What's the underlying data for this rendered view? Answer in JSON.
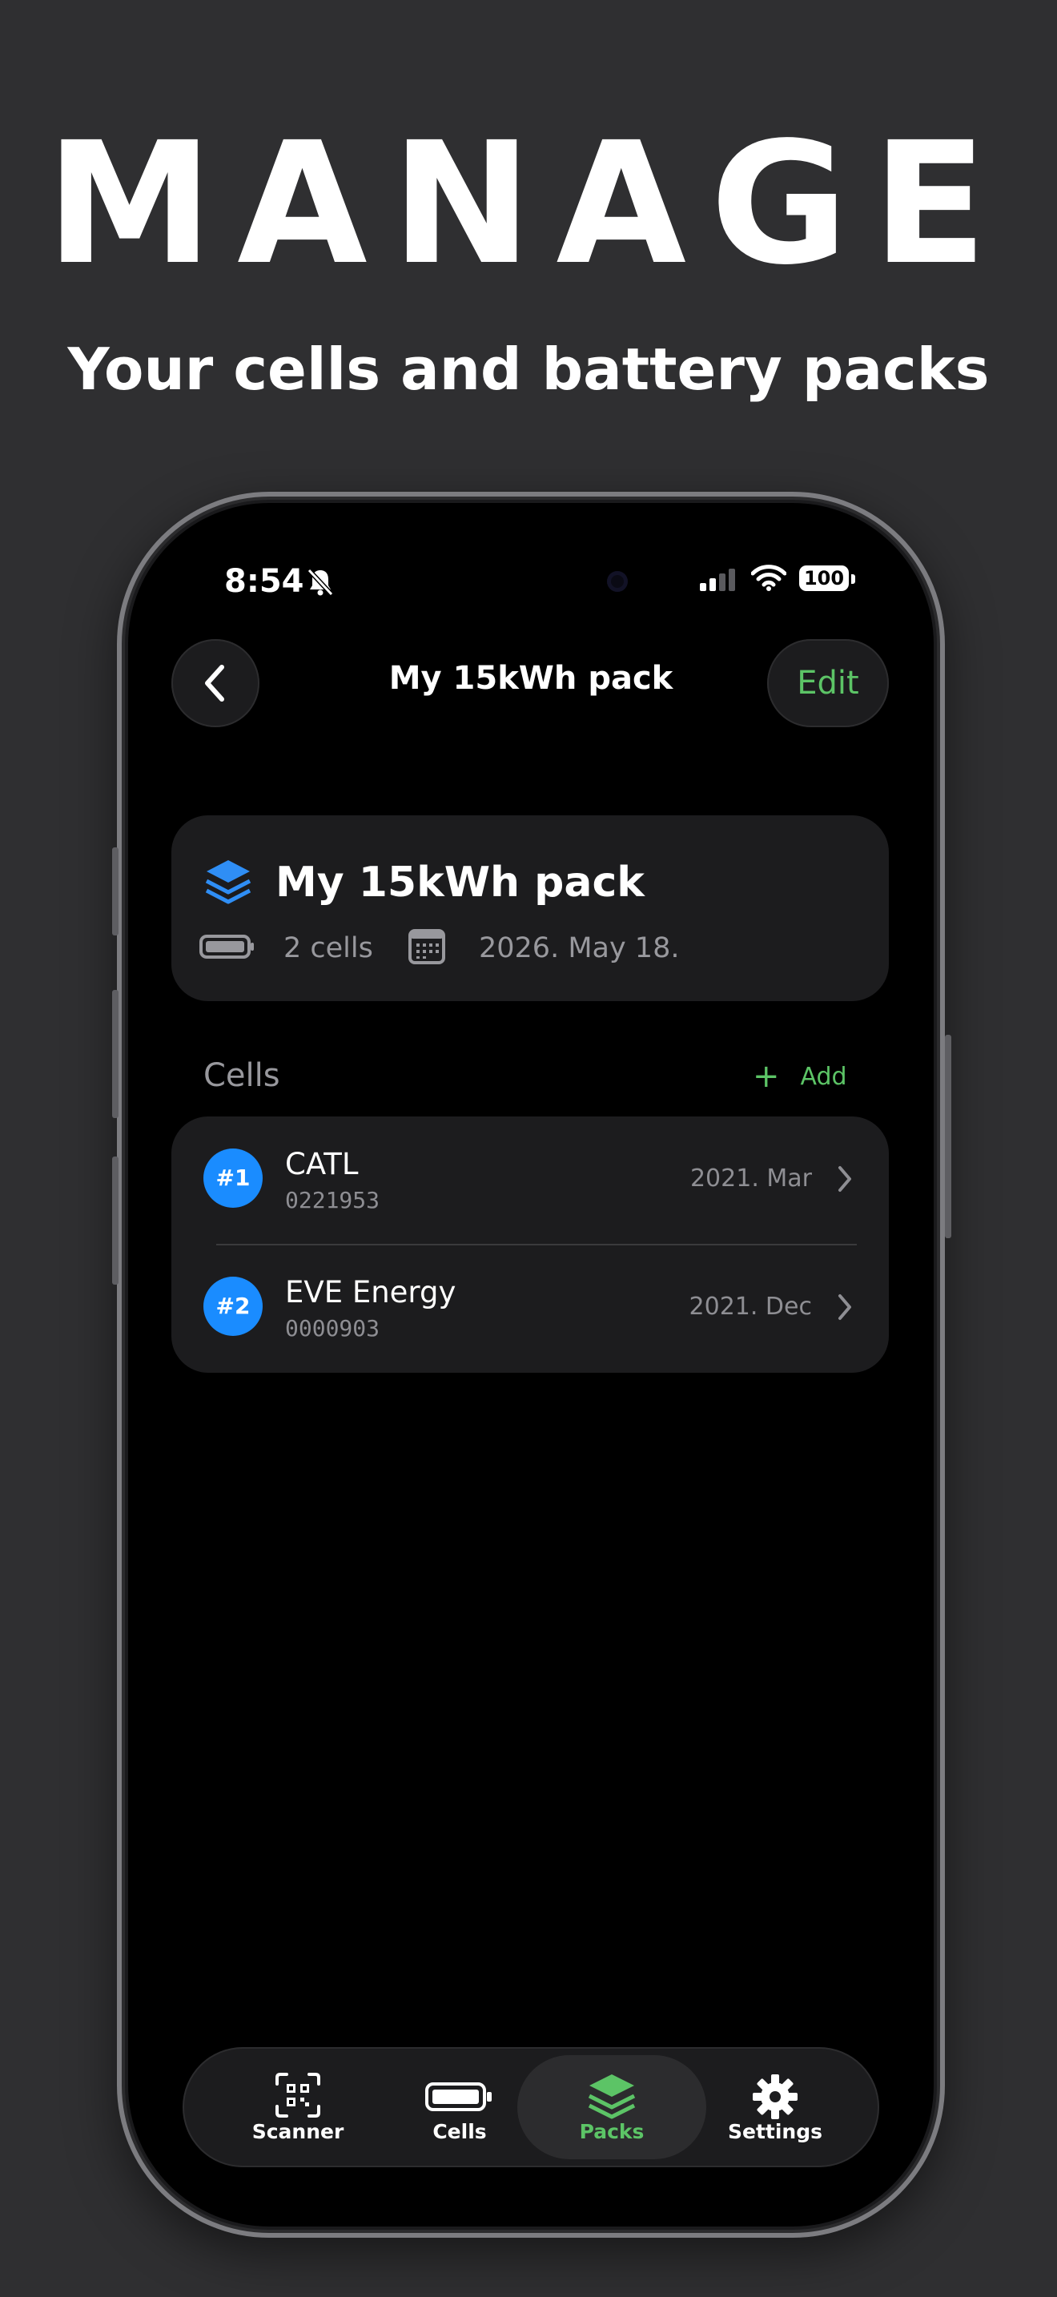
{
  "promo": {
    "headline": "MANAGE",
    "subheadline": "Your cells and battery packs"
  },
  "status_bar": {
    "time": "8:54",
    "battery_level": "100",
    "icons": [
      "bell-slash-icon",
      "signal-icon",
      "wifi-icon",
      "battery-icon"
    ]
  },
  "nav": {
    "title": "My 15kWh pack",
    "edit_label": "Edit",
    "back_icon": "chevron-left-icon"
  },
  "pack": {
    "name": "My 15kWh pack",
    "cells_count": "2 cells",
    "date": "2026. May 18.",
    "icon": "stack-layers-icon"
  },
  "cells_section": {
    "title": "Cells",
    "add_label": "Add",
    "add_icon": "+",
    "items": [
      {
        "badge": "#1",
        "brand": "CATL",
        "serial": "0221953",
        "date": "2021. Mar"
      },
      {
        "badge": "#2",
        "brand": "EVE Energy",
        "serial": "0000903",
        "date": "2021. Dec"
      }
    ]
  },
  "tab_bar": {
    "tabs": [
      {
        "label": "Scanner",
        "icon": "qr-scanner-icon",
        "active": false
      },
      {
        "label": "Cells",
        "icon": "battery-icon",
        "active": false
      },
      {
        "label": "Packs",
        "icon": "stack-layers-icon",
        "active": true
      },
      {
        "label": "Settings",
        "icon": "gear-icon",
        "active": false
      }
    ]
  },
  "colors": {
    "background": "#2f2f31",
    "screen": "#000000",
    "card": "#1c1c1e",
    "accent_green": "#5cc466",
    "badge_blue": "#1a8cff",
    "secondary_text": "#98989d"
  }
}
